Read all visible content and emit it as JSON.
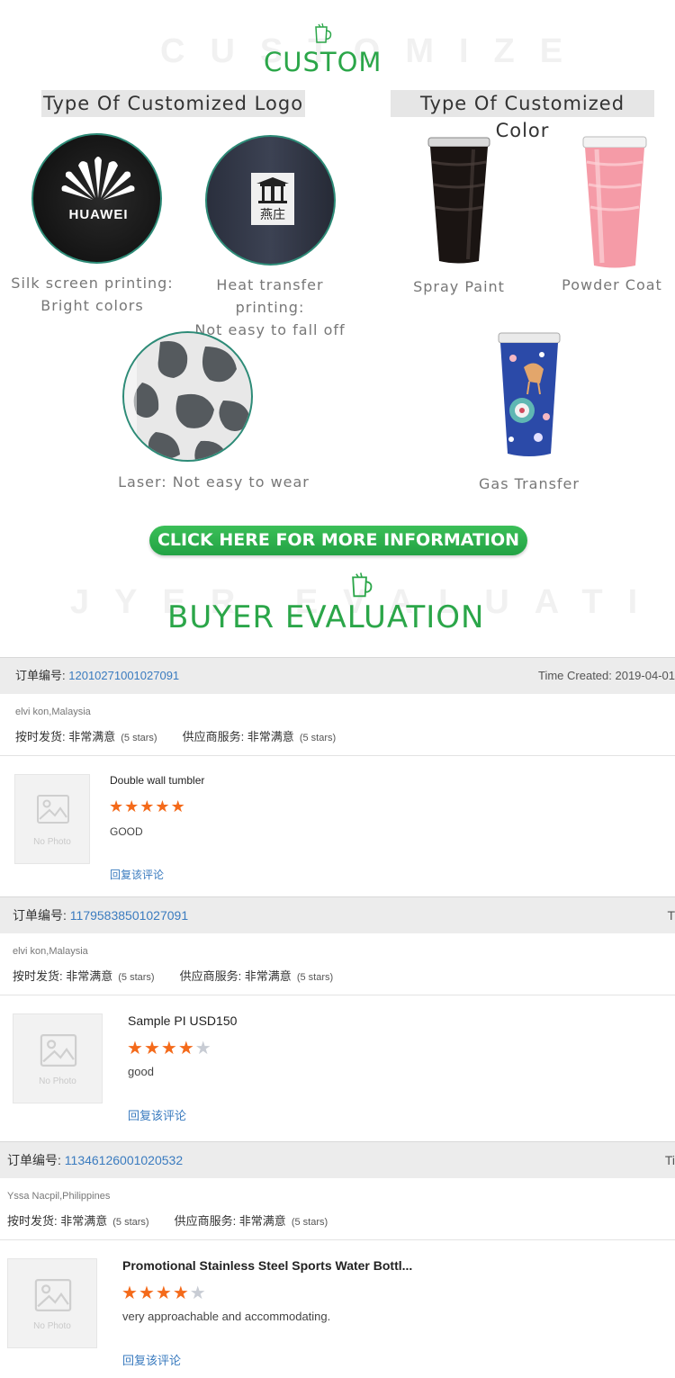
{
  "custom_section": {
    "ghost_text": "CUSTOMIZE",
    "title": "CUSTOM",
    "logo_label": "Type Of Customized Logo",
    "color_label": "Type Of Customized Color",
    "huawei_brand": "HUAWEI",
    "heat_logo_text": "燕庄",
    "captions": {
      "silk_1": "Silk screen printing:",
      "silk_2": "Bright colors",
      "heat_1": "Heat transfer printing:",
      "heat_2": "Not easy to fall off",
      "spray": "Spray Paint",
      "powder": "Powder Coat",
      "laser": "Laser:  Not easy to wear",
      "gas": "Gas Transfer"
    },
    "cta": "CLICK HERE FOR MORE INFORMATION"
  },
  "buyer_section": {
    "ghost_text": "JYER EVALUATI",
    "title": "BUYER EVALUATION"
  },
  "reviews": [
    {
      "order_label": "订单编号:",
      "order_number": "12010271001027091",
      "time_created": "Time Created: 2019-04-01",
      "buyer": "elvi kon,Malaysia",
      "delivery_label": "按时发货: 非常满意",
      "delivery_stars": "(5 stars)",
      "service_label": "供应商服务: 非常满意",
      "service_stars": "(5 stars)",
      "photo_placeholder": "No Photo",
      "product": "Double wall tumbler",
      "rating": 5,
      "comment": "GOOD",
      "reply": "回复该评论"
    },
    {
      "order_label": "订单编号:",
      "order_number": "11795838501027091",
      "time_created": "T",
      "buyer": "elvi kon,Malaysia",
      "delivery_label": "按时发货: 非常满意",
      "delivery_stars": "(5 stars)",
      "service_label": "供应商服务: 非常满意",
      "service_stars": "(5 stars)",
      "photo_placeholder": "No Photo",
      "product": "Sample PI USD150",
      "rating": 4,
      "comment": "good",
      "reply": "回复该评论"
    },
    {
      "order_label": "订单编号:",
      "order_number": "11346126001020532",
      "time_created": "Ti",
      "buyer": "Yssa Nacpil,Philippines",
      "delivery_label": "按时发货: 非常满意",
      "delivery_stars": "(5 stars)",
      "service_label": "供应商服务: 非常满意",
      "service_stars": "(5 stars)",
      "photo_placeholder": "No Photo",
      "product": "Promotional Stainless Steel Sports Water Bottl...",
      "rating": 4,
      "comment": "very approachable and accommodating.",
      "reply": "回复该评论"
    }
  ],
  "colors": {
    "brand_green": "#2ba649",
    "star_active": "#f46a1a",
    "star_inactive": "#c8ccd4",
    "link_blue": "#3a7bbf"
  }
}
